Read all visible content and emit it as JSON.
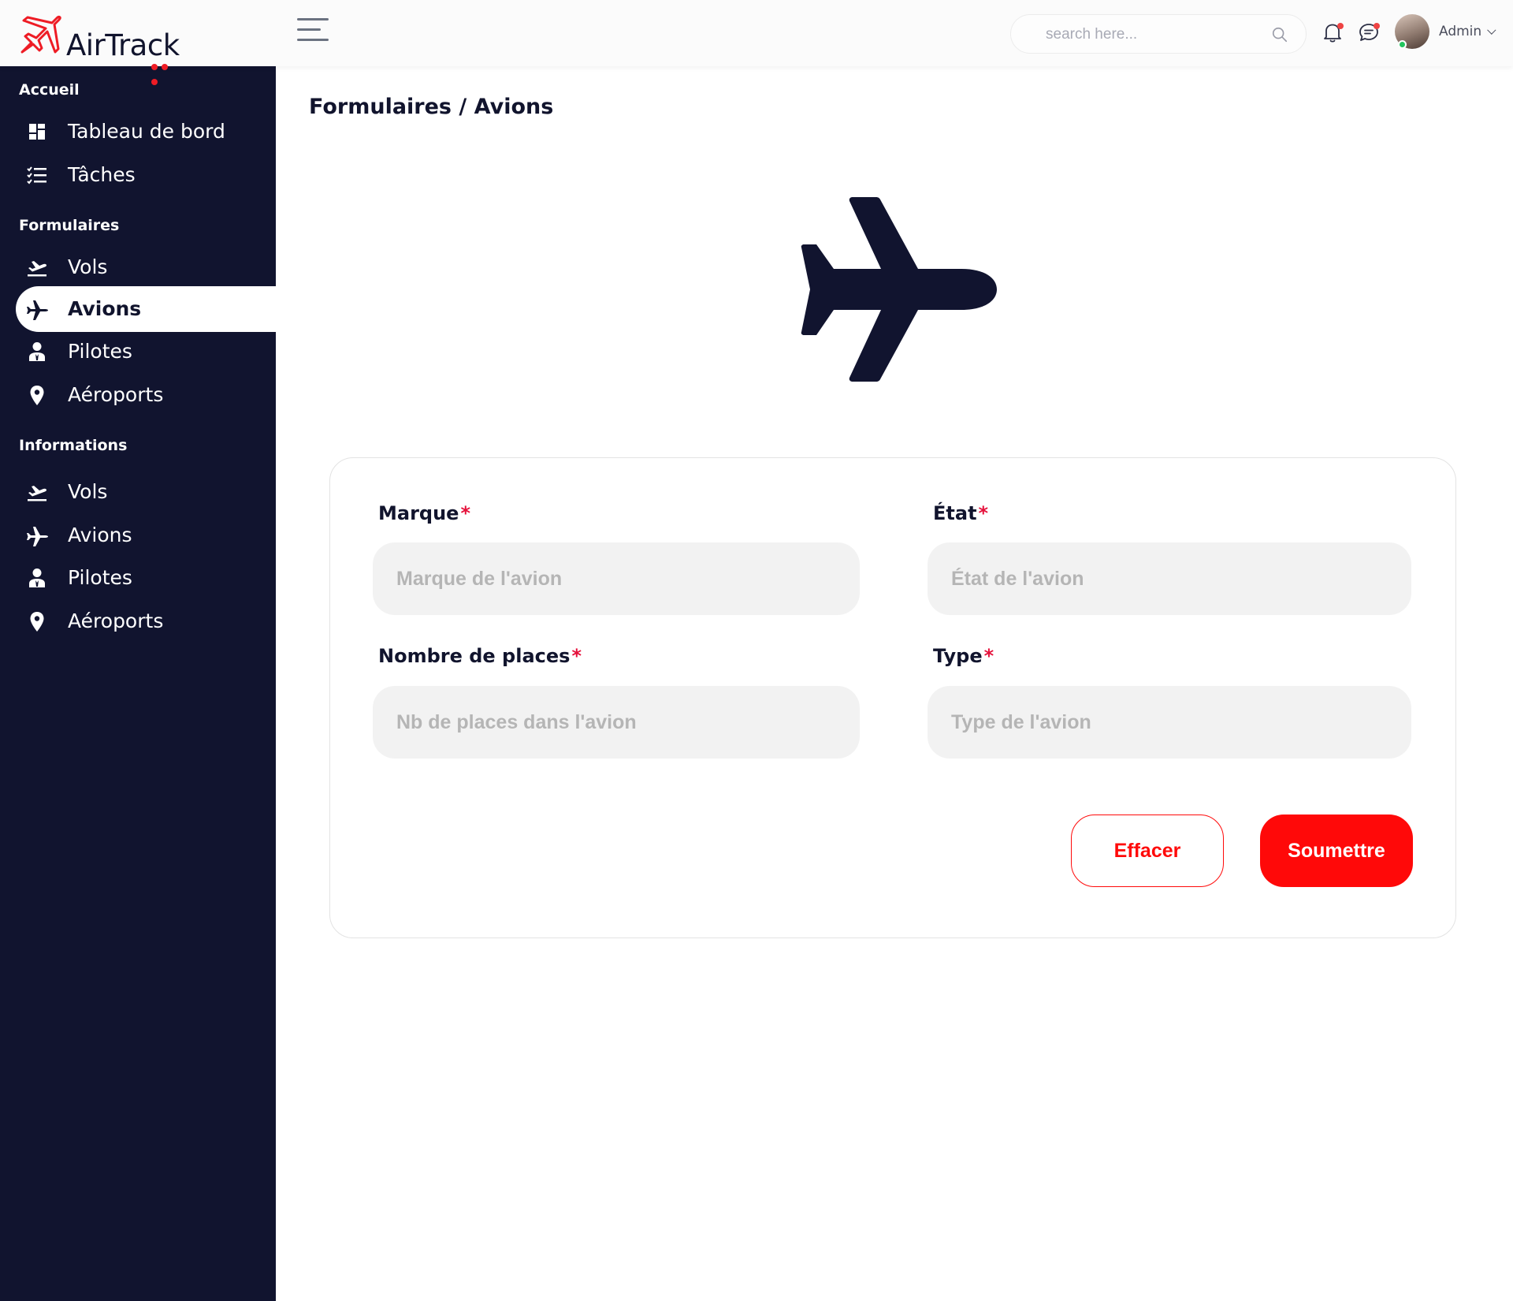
{
  "app": {
    "name": "AirTrack",
    "accent_color": "#ff0909",
    "sidebar_color": "#11142f"
  },
  "header": {
    "search_placeholder": "search here...",
    "icons": [
      "menu-icon",
      "search-icon",
      "bell-icon",
      "chat-icon"
    ],
    "user_name": "Admin"
  },
  "sidebar": {
    "sections": [
      {
        "title": "Accueil",
        "items": [
          {
            "label": "Tableau de bord",
            "icon": "dashboard-icon"
          },
          {
            "label": "Tâches",
            "icon": "task-list-icon"
          }
        ]
      },
      {
        "title": "Formulaires",
        "items": [
          {
            "label": "Vols",
            "icon": "flight-takeoff-icon"
          },
          {
            "label": "Avions",
            "icon": "airplane-icon",
            "active": true
          },
          {
            "label": "Pilotes",
            "icon": "pilot-icon"
          },
          {
            "label": "Aéroports",
            "icon": "location-pin-icon"
          }
        ]
      },
      {
        "title": "Informations",
        "items": [
          {
            "label": "Vols",
            "icon": "flight-takeoff-icon"
          },
          {
            "label": "Avions",
            "icon": "airplane-icon"
          },
          {
            "label": "Pilotes",
            "icon": "pilot-icon"
          },
          {
            "label": "Aéroports",
            "icon": "location-pin-icon"
          }
        ]
      }
    ]
  },
  "main": {
    "breadcrumb": "Formulaires / Avions",
    "hero_icon": "airplane-icon",
    "form": {
      "fields": [
        {
          "label": "Marque",
          "placeholder": "Marque de l'avion",
          "value": ""
        },
        {
          "label": "État",
          "placeholder": "État de l'avion",
          "value": ""
        },
        {
          "label": "Nombre de places",
          "placeholder": "Nb de places dans l'avion",
          "value": ""
        },
        {
          "label": "Type",
          "placeholder": "Type de l'avion",
          "value": ""
        }
      ],
      "required_mark": "*",
      "clear_label": "Effacer",
      "submit_label": "Soumettre"
    }
  }
}
